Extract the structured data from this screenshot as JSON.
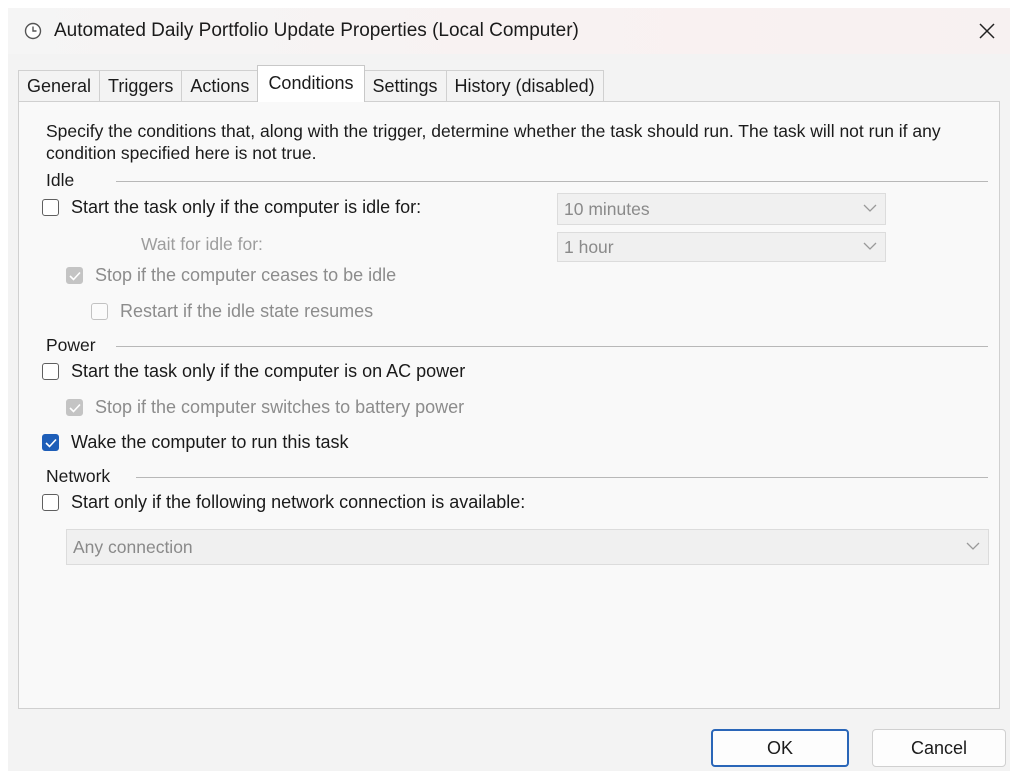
{
  "window": {
    "title": "Automated Daily Portfolio Update Properties (Local Computer)",
    "title_icon": "clock-icon",
    "close_icon": "close-icon"
  },
  "tabs": [
    {
      "label": "General"
    },
    {
      "label": "Triggers"
    },
    {
      "label": "Actions"
    },
    {
      "label": "Conditions",
      "active": true
    },
    {
      "label": "Settings"
    },
    {
      "label": "History (disabled)"
    }
  ],
  "description": "Specify the conditions that, along with the trigger, determine whether the task should run.  The task will not run  if any condition specified here is not true.",
  "idle": {
    "group_label": "Idle",
    "start_if_idle": {
      "label": "Start the task only if the computer is idle for:",
      "checked": false
    },
    "idle_duration": {
      "value": "10 minutes"
    },
    "wait_label": "Wait for idle for:",
    "wait_duration": {
      "value": "1 hour"
    },
    "stop_if_ceases": {
      "label": "Stop if the computer ceases to be idle",
      "checked": true,
      "enabled": false
    },
    "restart_if_resumes": {
      "label": "Restart if the idle state resumes",
      "checked": false,
      "enabled": false
    }
  },
  "power": {
    "group_label": "Power",
    "ac_power": {
      "label": "Start the task only if the computer is on AC power",
      "checked": false
    },
    "stop_on_battery": {
      "label": "Stop if the computer switches to battery power",
      "checked": true,
      "enabled": false
    },
    "wake": {
      "label": "Wake the computer to run this task",
      "checked": true
    }
  },
  "network": {
    "group_label": "Network",
    "start_if_network": {
      "label": "Start only if the following network connection is available:",
      "checked": false
    },
    "connection": {
      "value": "Any connection"
    }
  },
  "buttons": {
    "ok": "OK",
    "cancel": "Cancel"
  },
  "colors": {
    "accent": "#1e5eb8",
    "primary_border": "#2a66b8"
  }
}
